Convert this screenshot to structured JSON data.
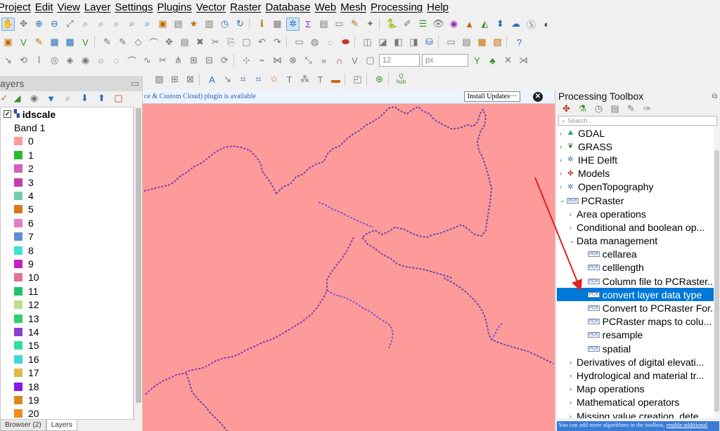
{
  "menu": [
    "Project",
    "Edit",
    "View",
    "Layer",
    "Settings",
    "Plugins",
    "Vector",
    "Raster",
    "Database",
    "Web",
    "Mesh",
    "Processing",
    "Help"
  ],
  "toolbar3": {
    "size_value": "12",
    "size_unit": "px"
  },
  "toolbar4": {
    "hub_label": "hub"
  },
  "message_bar": {
    "text": "ce & Custom Cloud) plugin is available",
    "button": "Install Updates···"
  },
  "layers_panel": {
    "title": "ayers",
    "layer_name": "idscale",
    "band_label": "Band 1",
    "classes": [
      {
        "label": "0",
        "color": "#fd9b9b"
      },
      {
        "label": "1",
        "color": "#2eb82e"
      },
      {
        "label": "2",
        "color": "#d35fbf"
      },
      {
        "label": "3",
        "color": "#c23fb0"
      },
      {
        "label": "4",
        "color": "#6fcfa8"
      },
      {
        "label": "5",
        "color": "#d87a1c"
      },
      {
        "label": "6",
        "color": "#e07ec8"
      },
      {
        "label": "7",
        "color": "#5b8fd6"
      },
      {
        "label": "8",
        "color": "#3fe0d0"
      },
      {
        "label": "9",
        "color": "#c520c5"
      },
      {
        "label": "10",
        "color": "#e0739a"
      },
      {
        "label": "11",
        "color": "#1fc46a"
      },
      {
        "label": "12",
        "color": "#b8e08a"
      },
      {
        "label": "13",
        "color": "#2fd06a"
      },
      {
        "label": "14",
        "color": "#8a3fd0"
      },
      {
        "label": "15",
        "color": "#2ee0a0"
      },
      {
        "label": "16",
        "color": "#3fd8d8"
      },
      {
        "label": "17",
        "color": "#e0b850"
      },
      {
        "label": "18",
        "color": "#8a18e8"
      },
      {
        "label": "19",
        "color": "#d88a20"
      },
      {
        "label": "20",
        "color": "#f08a1c"
      }
    ],
    "tabs": [
      "Browser (2)",
      "Layers"
    ]
  },
  "toolbox": {
    "title": "Processing Toolbox",
    "search_placeholder": "Search...",
    "providers": [
      {
        "label": "GDAL"
      },
      {
        "label": "GRASS"
      },
      {
        "label": "IHE Delft"
      },
      {
        "label": "Models"
      },
      {
        "label": "OpenTopography"
      },
      {
        "label": "PCRaster"
      }
    ],
    "groups_a": [
      "Area operations",
      "Conditional and boolean op...",
      "Data management"
    ],
    "algorithms": [
      "cellarea",
      "celllength",
      "Column file to PCRaster...",
      "convert layer data type",
      "Convert to PCRaster For...",
      "PCRaster maps to colu...",
      "resample",
      "spatial"
    ],
    "groups_b": [
      "Derivatives of digital elevati...",
      "Hydrological and material tr...",
      "Map operations",
      "Mathematical operators",
      "Missing value creation, dete..."
    ],
    "info_text": "You can add more algorithms to the toolbox,",
    "info_link": "enable additional"
  },
  "colors": {
    "canvas": "#fd9b9b",
    "selection": "#0078d7",
    "annotation_arrow": "#e02020"
  }
}
